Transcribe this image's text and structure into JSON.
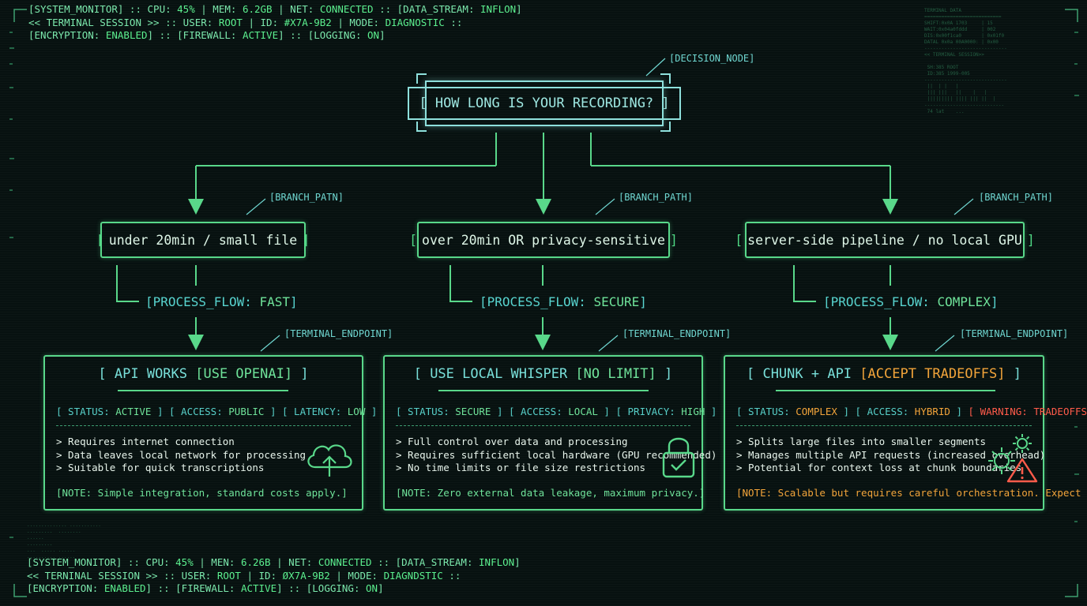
{
  "header_top": {
    "line1": [
      {
        "t": "[SYSTEM_MONITOR] :: CPU: ",
        "c": "lbl"
      },
      {
        "t": "45%",
        "c": "val"
      },
      {
        "t": " | MEM: ",
        "c": "lbl"
      },
      {
        "t": "6.2GB",
        "c": "val"
      },
      {
        "t": " | NET: ",
        "c": "lbl"
      },
      {
        "t": "CONNECTED",
        "c": "val"
      },
      {
        "t": " :: [DATA_STREAM: ",
        "c": "lbl"
      },
      {
        "t": "INFLON",
        "c": "val"
      },
      {
        "t": "]",
        "c": "lbl"
      }
    ],
    "line2": [
      {
        "t": "<< TERMINAL SESSION >> :: USER: ",
        "c": "lbl"
      },
      {
        "t": "ROOT",
        "c": "val"
      },
      {
        "t": " | ID: ",
        "c": "lbl"
      },
      {
        "t": "#X7A-9B2",
        "c": "val"
      },
      {
        "t": " | MODE: ",
        "c": "lbl"
      },
      {
        "t": "DIAGNOSTIC",
        "c": "val"
      },
      {
        "t": " ::",
        "c": "lbl"
      }
    ],
    "line3": [
      {
        "t": "[ENCRYPTION: ",
        "c": "lbl"
      },
      {
        "t": "ENABLED",
        "c": "val"
      },
      {
        "t": "] :: [FIREWALL: ",
        "c": "lbl"
      },
      {
        "t": "ACTIVE",
        "c": "val"
      },
      {
        "t": "] :: [LOGGING: ",
        "c": "lbl"
      },
      {
        "t": "ON",
        "c": "val"
      },
      {
        "t": "]",
        "c": "lbl"
      }
    ]
  },
  "header_bottom": {
    "line1": [
      {
        "t": "[SYSTEM_MONITOR] :: CPU: ",
        "c": "lbl"
      },
      {
        "t": "45%",
        "c": "val"
      },
      {
        "t": " | MEN: ",
        "c": "lbl"
      },
      {
        "t": "6.26B",
        "c": "val"
      },
      {
        "t": " | NET: ",
        "c": "lbl"
      },
      {
        "t": "CONNECTED",
        "c": "val"
      },
      {
        "t": " :: [DATA_STREAM: ",
        "c": "lbl"
      },
      {
        "t": "INFLON",
        "c": "val"
      },
      {
        "t": "]",
        "c": "lbl"
      }
    ],
    "line2": [
      {
        "t": "<< TERNINAL SESSION >> :: USER: ",
        "c": "lbl"
      },
      {
        "t": "ROOT",
        "c": "val"
      },
      {
        "t": " | ID: ",
        "c": "lbl"
      },
      {
        "t": "ØX7A-9B2",
        "c": "val"
      },
      {
        "t": " | MODE: ",
        "c": "lbl"
      },
      {
        "t": "DIAGNDSTIC",
        "c": "val"
      },
      {
        "t": " ::",
        "c": "lbl"
      }
    ],
    "line3": [
      {
        "t": "[ENCRYPTION: ",
        "c": "lbl"
      },
      {
        "t": "ENABLED",
        "c": "val"
      },
      {
        "t": "] :: [FIREWALL: ",
        "c": "lbl"
      },
      {
        "t": "ACTIVE",
        "c": "val"
      },
      {
        "t": "] :: [LOGGING: ",
        "c": "lbl"
      },
      {
        "t": "ON",
        "c": "val"
      },
      {
        "t": "]",
        "c": "lbl"
      }
    ]
  },
  "decision": {
    "tag": "[DECISION_NODE]",
    "question": "[ HOW LONG IS YOUR RECORDING? ]"
  },
  "branches": [
    {
      "tag": "[BRANCH_PATN]",
      "label": "under 20min / small file",
      "flow_key": "[PROCESS_FLOW: ",
      "flow_value": "FAST",
      "flow_end": "]",
      "endpoint_tag": "[TERMINAL_ENDPOINT]",
      "title_pre": "[ API WORKS ",
      "title_hl": "[USE OPENAI]",
      "title_post": " ]",
      "status": [
        {
          "t": "[ STATUS: ",
          "c": "k"
        },
        {
          "t": "ACTIVE",
          "c": "v"
        },
        {
          "t": " ] [ ACCESS: ",
          "c": "k"
        },
        {
          "t": "PUBLIC",
          "c": "v"
        },
        {
          "t": " ] [ LATENCY: ",
          "c": "k"
        },
        {
          "t": "LOW",
          "c": "v"
        },
        {
          "t": " ]",
          "c": "k"
        }
      ],
      "bullets": [
        "> Requires internet connection",
        "> Data leaves local network for processing",
        "> Suitable for quick transcriptions"
      ],
      "note": "[NOTE: Simple integration, standard costs apply.]",
      "icon": "cloud-upload-icon"
    },
    {
      "tag": "[BRANCH_PATH]",
      "label": "over 20min OR privacy-sensitive",
      "flow_key": "[PROCESS_FLOW: ",
      "flow_value": "SECURE",
      "flow_end": "]",
      "endpoint_tag": "[TERMINAL_ENDPOINT]",
      "title_pre": "[ USE LOCAL WHISPER ",
      "title_hl": "[NO LIMIT]",
      "title_post": " ]",
      "status": [
        {
          "t": "[ STATUS: ",
          "c": "k"
        },
        {
          "t": "SECURE",
          "c": "v"
        },
        {
          "t": " ] [ ACCESS: ",
          "c": "k"
        },
        {
          "t": "LOCAL",
          "c": "v"
        },
        {
          "t": " ] [ PRIVACY: ",
          "c": "k"
        },
        {
          "t": "HIGH",
          "c": "v"
        },
        {
          "t": " ]",
          "c": "k"
        }
      ],
      "bullets": [
        "> Full control over data and processing",
        "> Requires sufficient local hardware (GPU recommended)",
        "> No time limits or file size restrictions"
      ],
      "note": "[NOTE: Zero external data leakage, maximum privacy.]",
      "icon": "padlock-check-icon"
    },
    {
      "tag": "[BRANCH_PATH]",
      "label": "server-side pipeline / no local GPU",
      "flow_key": "[PROCESS_FLOW: ",
      "flow_value": "COMPLEX",
      "flow_end": "]",
      "endpoint_tag": "[TERMINAL_ENDPOINT]",
      "title_pre": "[ CHUNK + API ",
      "title_hl": "[ACCEPT TRADEOFFS]",
      "title_post": " ]",
      "status": [
        {
          "t": "[ STATUS: ",
          "c": "k"
        },
        {
          "t": "COMPLEX",
          "c": "o"
        },
        {
          "t": " ] [ ACCESS: ",
          "c": "k"
        },
        {
          "t": "HYBRID",
          "c": "o"
        },
        {
          "t": " ] ",
          "c": "k"
        },
        {
          "t": "[ WARNING: TRADEOFFS ]",
          "c": "r"
        }
      ],
      "bullets": [
        "> Splits large files into smaller segments",
        "> Manages multiple API requests (increased overhead)",
        "> Potential for context loss at chunk boundaries"
      ],
      "note": "[NOTE: Scalable but requires careful orchestration. Expect latency.]",
      "icon": "gears-warning-icon"
    }
  ],
  "colors": {
    "accent": "#5fe08a",
    "cyan": "#7fe3e0",
    "orange": "#f2a43a",
    "red": "#ff5b4a",
    "background": "#071110"
  }
}
